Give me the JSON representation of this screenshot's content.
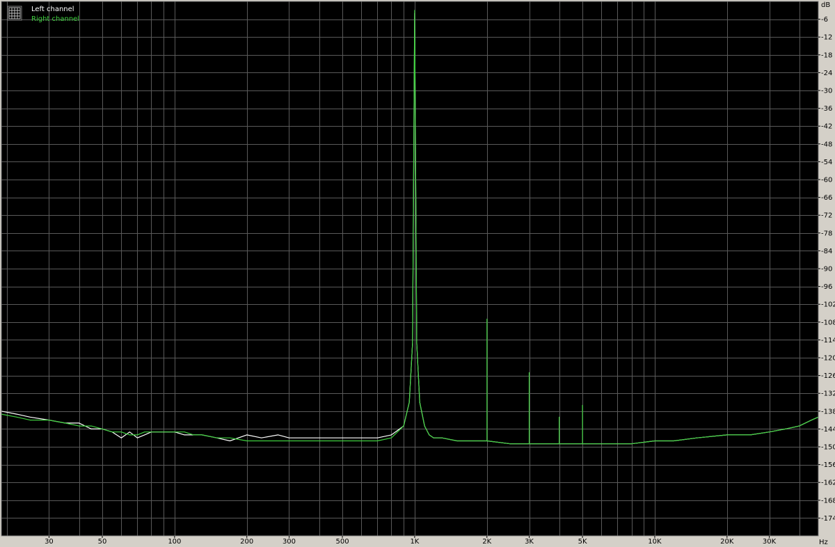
{
  "chart_data": {
    "type": "line",
    "x_scale": "log",
    "x_unit": "Hz",
    "y_unit": "dB",
    "xlim": [
      19,
      48000
    ],
    "ylim": [
      -180,
      0
    ],
    "grid": true,
    "legend_position": "top-left",
    "x_tick_labels": [
      {
        "value": 30,
        "label": "30"
      },
      {
        "value": 50,
        "label": "50"
      },
      {
        "value": 100,
        "label": "100"
      },
      {
        "value": 200,
        "label": "200"
      },
      {
        "value": 300,
        "label": "300"
      },
      {
        "value": 500,
        "label": "500"
      },
      {
        "value": 1000,
        "label": "1K"
      },
      {
        "value": 2000,
        "label": "2K"
      },
      {
        "value": 3000,
        "label": "3K"
      },
      {
        "value": 5000,
        "label": "5K"
      },
      {
        "value": 10000,
        "label": "10K"
      },
      {
        "value": 20000,
        "label": "20K"
      },
      {
        "value": 30000,
        "label": "30K"
      }
    ],
    "y_ticks": [
      -6,
      -12,
      -18,
      -24,
      -30,
      -36,
      -42,
      -48,
      -54,
      -60,
      -66,
      -72,
      -78,
      -84,
      -90,
      -96,
      -102,
      -108,
      -114,
      -120,
      -126,
      -132,
      -138,
      -144,
      -150,
      -156,
      -162,
      -168,
      -174
    ],
    "series": [
      {
        "name": "Left channel",
        "color": "#ffffff",
        "x": [
          19,
          22,
          25,
          30,
          35,
          40,
          45,
          50,
          55,
          60,
          65,
          70,
          75,
          80,
          90,
          100,
          110,
          120,
          130,
          150,
          170,
          200,
          230,
          270,
          300,
          350,
          400,
          450,
          500,
          600,
          700,
          800,
          900,
          950,
          980,
          1000,
          1020,
          1050,
          1100,
          1150,
          1200,
          1300,
          1500,
          1700,
          2000,
          2500,
          3000,
          3500,
          4000,
          5000,
          6000,
          7000,
          8000,
          10000,
          12000,
          15000,
          20000,
          25000,
          30000,
          35000,
          40000,
          45000,
          48000
        ],
        "y": [
          -138,
          -139,
          -140,
          -141,
          -142,
          -142,
          -144,
          -144,
          -145,
          -147,
          -145,
          -147,
          -146,
          -145,
          -145,
          -145,
          -146,
          -146,
          -146,
          -147,
          -148,
          -146,
          -147,
          -146,
          -147,
          -147,
          -147,
          -147,
          -147,
          -147,
          -147,
          -146,
          -143,
          -135,
          -115,
          -4,
          -115,
          -135,
          -143,
          -146,
          -147,
          -147,
          -148,
          -148,
          -148,
          -149,
          -149,
          -149,
          -149,
          -149,
          -149,
          -149,
          -149,
          -148,
          -148,
          -147,
          -146,
          -146,
          -145,
          -144,
          -143,
          -141,
          -140
        ]
      },
      {
        "name": "Right channel",
        "color": "#3ed03e",
        "x": [
          19,
          22,
          25,
          30,
          35,
          40,
          45,
          50,
          55,
          60,
          65,
          70,
          75,
          80,
          90,
          100,
          110,
          120,
          130,
          150,
          170,
          200,
          230,
          270,
          300,
          350,
          400,
          450,
          500,
          600,
          700,
          800,
          900,
          950,
          980,
          1000,
          1020,
          1050,
          1100,
          1150,
          1200,
          1300,
          1500,
          1700,
          2000,
          2000,
          2000,
          2500,
          3000,
          3000,
          3000,
          3500,
          4000,
          4000,
          4000,
          5000,
          5000,
          5000,
          6000,
          7000,
          8000,
          10000,
          12000,
          15000,
          20000,
          25000,
          30000,
          35000,
          40000,
          45000,
          48000
        ],
        "y": [
          -139,
          -140,
          -141,
          -141,
          -142,
          -143,
          -143,
          -144,
          -145,
          -145,
          -146,
          -146,
          -145,
          -145,
          -145,
          -145,
          -145,
          -146,
          -146,
          -147,
          -147,
          -148,
          -148,
          -148,
          -148,
          -148,
          -148,
          -148,
          -148,
          -148,
          -148,
          -147,
          -143,
          -135,
          -115,
          -3,
          -115,
          -135,
          -143,
          -146,
          -147,
          -147,
          -148,
          -148,
          -148,
          -107,
          -148,
          -149,
          -149,
          -125,
          -149,
          -149,
          -149,
          -140,
          -149,
          -149,
          -136,
          -149,
          -149,
          -149,
          -149,
          -148,
          -148,
          -147,
          -146,
          -146,
          -145,
          -144,
          -143,
          -141,
          -140
        ]
      }
    ]
  }
}
